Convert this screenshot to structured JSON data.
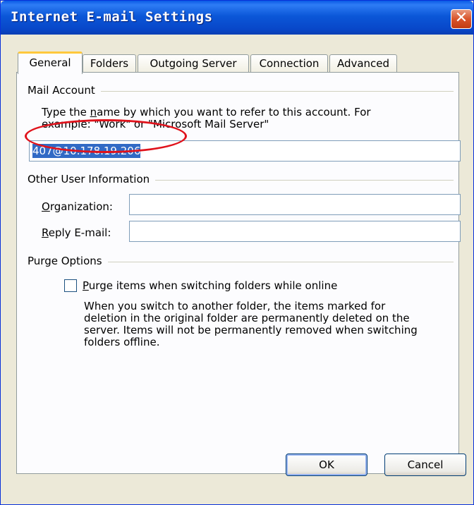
{
  "window": {
    "title": "Internet E-mail Settings"
  },
  "tabs": [
    {
      "label": "General",
      "active": true
    },
    {
      "label": "Folders",
      "active": false
    },
    {
      "label": "Outgoing Server",
      "active": false
    },
    {
      "label": "Connection",
      "active": false
    },
    {
      "label": "Advanced",
      "active": false
    }
  ],
  "mail_account": {
    "group_label": "Mail Account",
    "description_line1_pre": "Type the ",
    "description_line1_key": "n",
    "description_line1_post": "ame by which you want to refer to this account. For",
    "description_line2": "example: \"Work\" or \"Microsoft Mail Server\"",
    "account_name_value": "407@10.178.19.206"
  },
  "other_user_info": {
    "group_label": "Other User Information",
    "organization_key": "O",
    "organization_rest": "rganization:",
    "organization_value": "",
    "reply_key": "R",
    "reply_rest": "eply E-mail:",
    "reply_value": ""
  },
  "purge_options": {
    "group_label": "Purge Options",
    "checkbox_key": "P",
    "checkbox_rest": "urge items when switching folders while online",
    "checked": false,
    "help_line1": "When you switch to another folder, the items marked for",
    "help_line2": "deletion in the original folder are permanently deleted on the",
    "help_line3": "server. Items will not be permanently removed when switching",
    "help_line4": "folders offline."
  },
  "buttons": {
    "ok": "OK",
    "cancel": "Cancel"
  },
  "colors": {
    "title_bar": "#0b57d8",
    "highlight": "#e0121b",
    "selection": "#316ac5"
  }
}
